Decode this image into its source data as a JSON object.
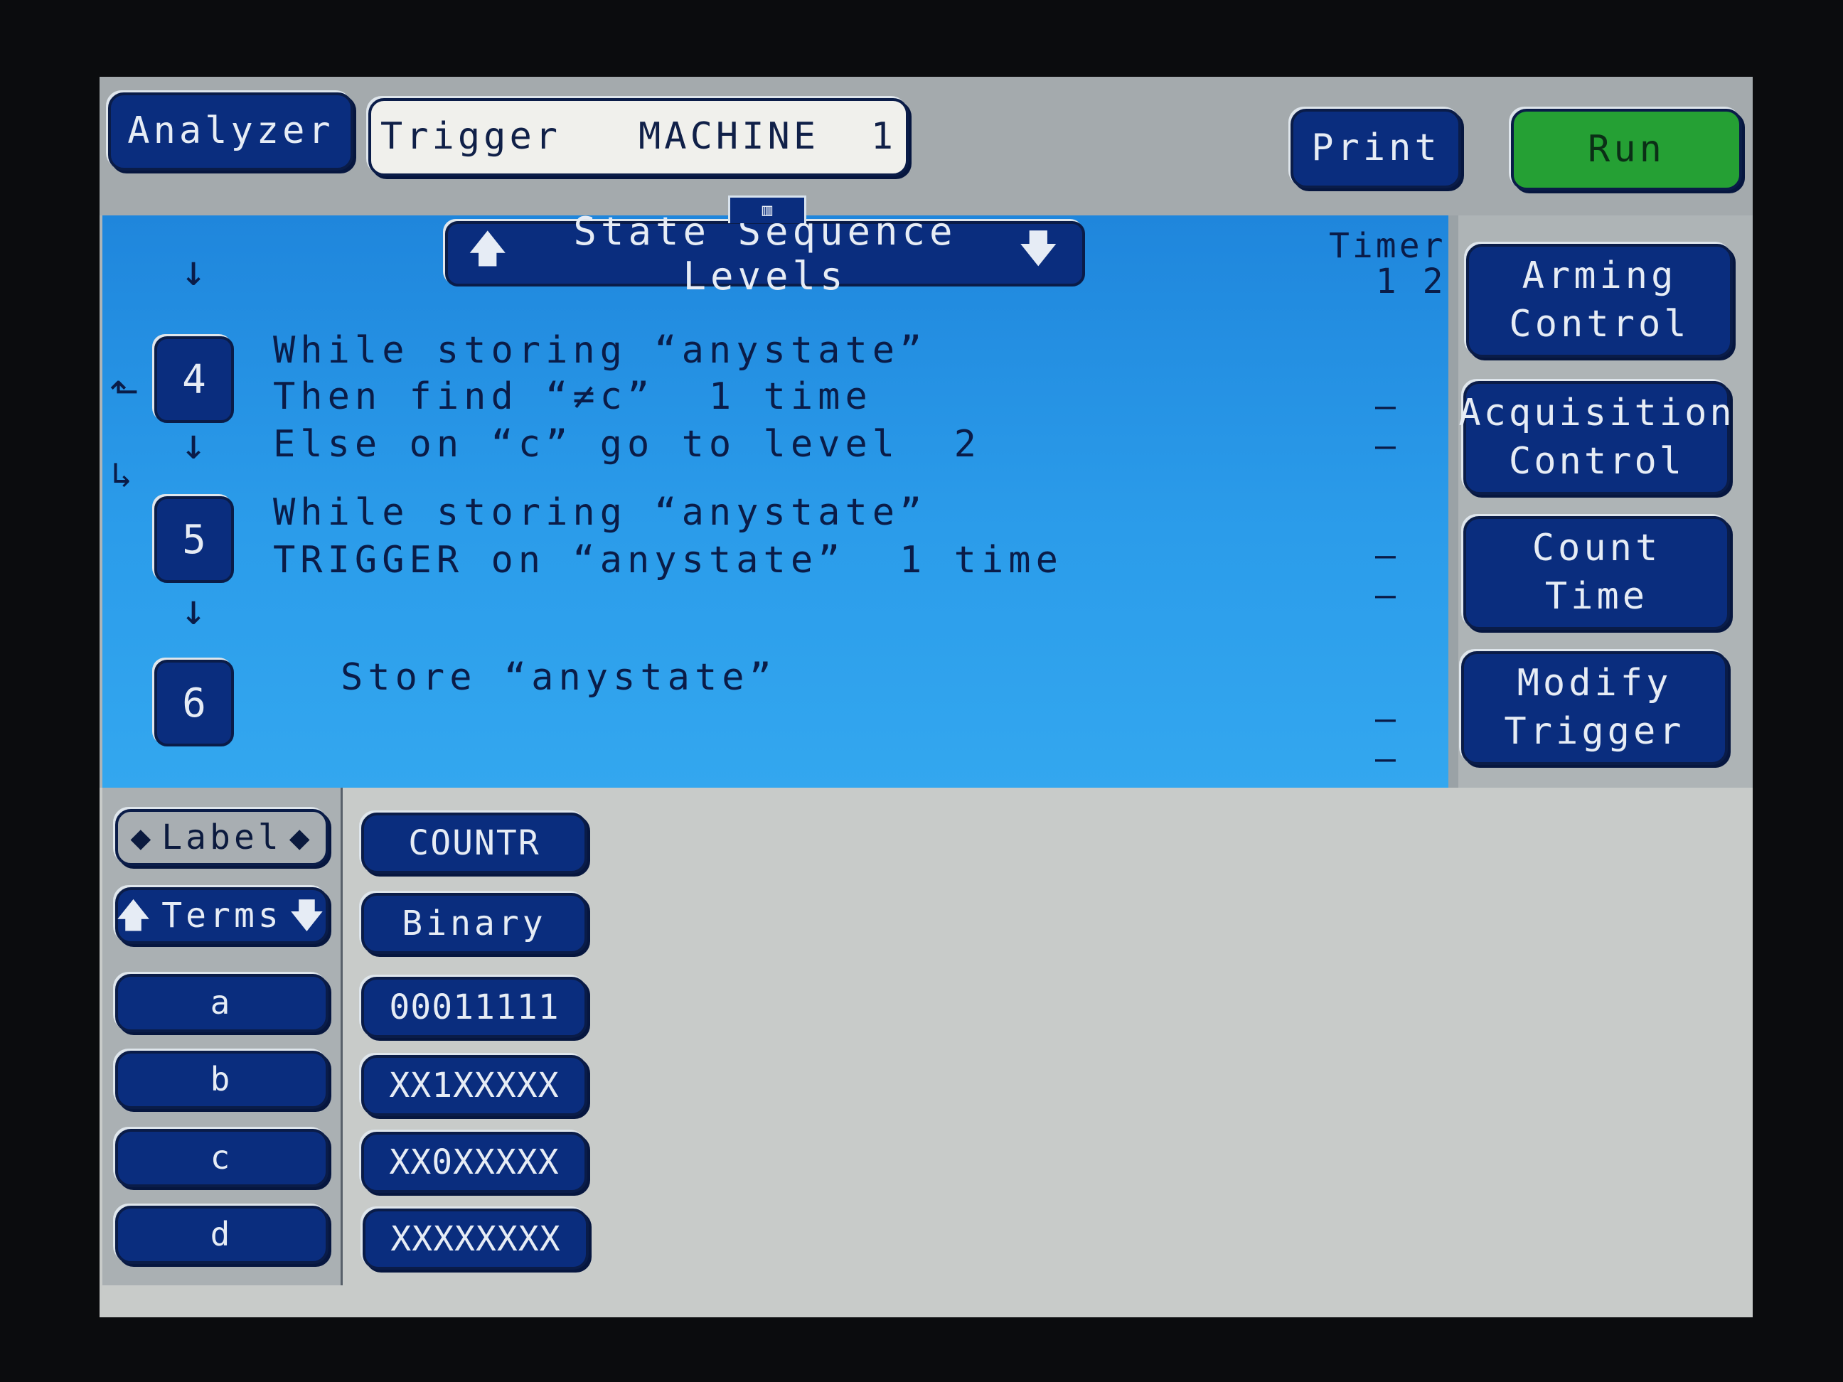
{
  "header": {
    "analyzer_label": "Analyzer",
    "trigger_label": "Trigger   MACHINE  1",
    "print_label": "Print",
    "run_label": "Run"
  },
  "sequence": {
    "title": "State Sequence Levels",
    "timer_label": "Timer",
    "timer_columns": "1 2",
    "levels": [
      {
        "number": "4",
        "lines": [
          "While storing “anystate”",
          "Then find “≠c”  1 time",
          "Else on “c” go to level  2"
        ],
        "timer": "– –"
      },
      {
        "number": "5",
        "lines": [
          "While storing “anystate”",
          "TRIGGER on “anystate”  1 time"
        ],
        "timer": "– –"
      },
      {
        "number": "6",
        "lines": [
          "Store “anystate”"
        ],
        "timer": "– –"
      }
    ]
  },
  "side_menu": {
    "arming_1": "Arming",
    "arming_2": "Control",
    "acq_1": "Acquisition",
    "acq_2": "Control",
    "count_1": "Count",
    "count_2": "Time",
    "modify_1": "Modify",
    "modify_2": "Trigger"
  },
  "terms_panel": {
    "label_selector": "Label",
    "terms_selector": "Terms",
    "label_value": "COUNTR",
    "base_value": "Binary",
    "terms": [
      {
        "name": "a",
        "value": "00011111"
      },
      {
        "name": "b",
        "value": "XX1XXXXX"
      },
      {
        "name": "c",
        "value": "XX0XXXXX"
      },
      {
        "name": "d",
        "value": "XXXXXXXX"
      }
    ]
  },
  "colors": {
    "button_blue": "#0a2d7e",
    "run_green": "#25a034",
    "panel_blue": "#2b9cea"
  }
}
